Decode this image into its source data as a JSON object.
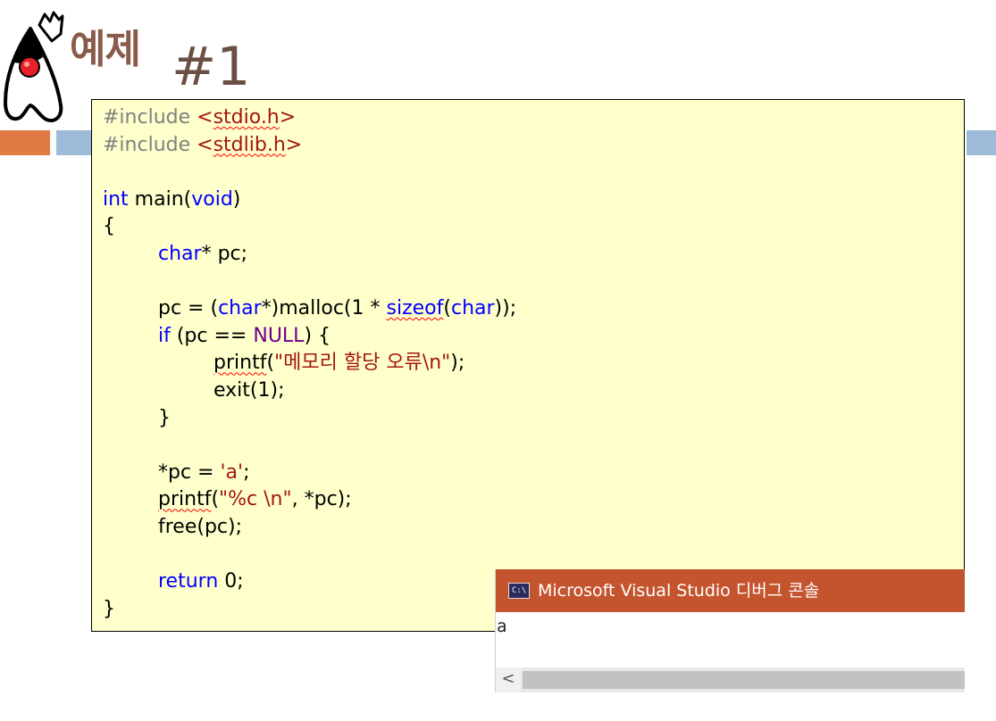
{
  "slide": {
    "title_korean": "예제",
    "title_number": "#1"
  },
  "code_lines": [
    [
      {
        "t": "#include ",
        "c": "pre"
      },
      {
        "t": "<",
        "c": "str"
      },
      {
        "t": "stdio.h",
        "c": "str sq"
      },
      {
        "t": ">",
        "c": "str"
      }
    ],
    [
      {
        "t": "#include ",
        "c": "pre"
      },
      {
        "t": "<",
        "c": "str"
      },
      {
        "t": "stdlib.h",
        "c": "str sq"
      },
      {
        "t": ">",
        "c": "str"
      }
    ],
    [],
    [
      {
        "t": "int",
        "c": "kw"
      },
      {
        "t": " main("
      },
      {
        "t": "void",
        "c": "kw"
      },
      {
        "t": ")"
      }
    ],
    [
      {
        "t": "{"
      }
    ],
    [
      {
        "t": "char",
        "c": "kw",
        "i": 1
      },
      {
        "t": "* pc;"
      }
    ],
    [],
    [
      {
        "t": "pc = (",
        "i": 1
      },
      {
        "t": "char",
        "c": "kw"
      },
      {
        "t": "*)malloc(1 * "
      },
      {
        "t": "sizeof",
        "c": "kw sq"
      },
      {
        "t": "("
      },
      {
        "t": "char",
        "c": "kw"
      },
      {
        "t": "));"
      }
    ],
    [
      {
        "t": "if",
        "c": "kw",
        "i": 1
      },
      {
        "t": " (pc == "
      },
      {
        "t": "NULL",
        "c": "mac"
      },
      {
        "t": ") {"
      }
    ],
    [
      {
        "t": "printf",
        "c": "sq",
        "i": 2
      },
      {
        "t": "("
      },
      {
        "t": "\"메모리 할당 오류\\n\"",
        "c": "str"
      },
      {
        "t": ");"
      }
    ],
    [
      {
        "t": "exit(1);",
        "i": 2
      }
    ],
    [
      {
        "t": "}",
        "i": 1
      }
    ],
    [],
    [
      {
        "t": "*pc = ",
        "i": 1
      },
      {
        "t": "'a'",
        "c": "str"
      },
      {
        "t": ";"
      }
    ],
    [
      {
        "t": "printf",
        "c": "sq",
        "i": 1
      },
      {
        "t": "("
      },
      {
        "t": "\"%c \\n\"",
        "c": "str"
      },
      {
        "t": ", *pc);"
      }
    ],
    [
      {
        "t": "free(pc);",
        "i": 1
      }
    ],
    [],
    [
      {
        "t": "return",
        "c": "kw",
        "i": 1
      },
      {
        "t": " 0;"
      }
    ],
    [
      {
        "t": "}"
      }
    ]
  ],
  "console": {
    "icon_text": "C:\\",
    "title": "Microsoft Visual Studio 디버그 콘솔",
    "output": "a",
    "scroll_left_glyph": "<"
  },
  "colors": {
    "keyword": "#0000ff",
    "preprocessor": "#808080",
    "string": "#a31515",
    "macro": "#6f008a",
    "code_background": "#ffffcc",
    "console_titlebar": "#c4542e",
    "accent_orange": "#e07b45",
    "accent_blue": "#9dbbd8"
  },
  "icons": {
    "mascot": "java-duke-mascot-icon",
    "console": "console-window-icon"
  }
}
